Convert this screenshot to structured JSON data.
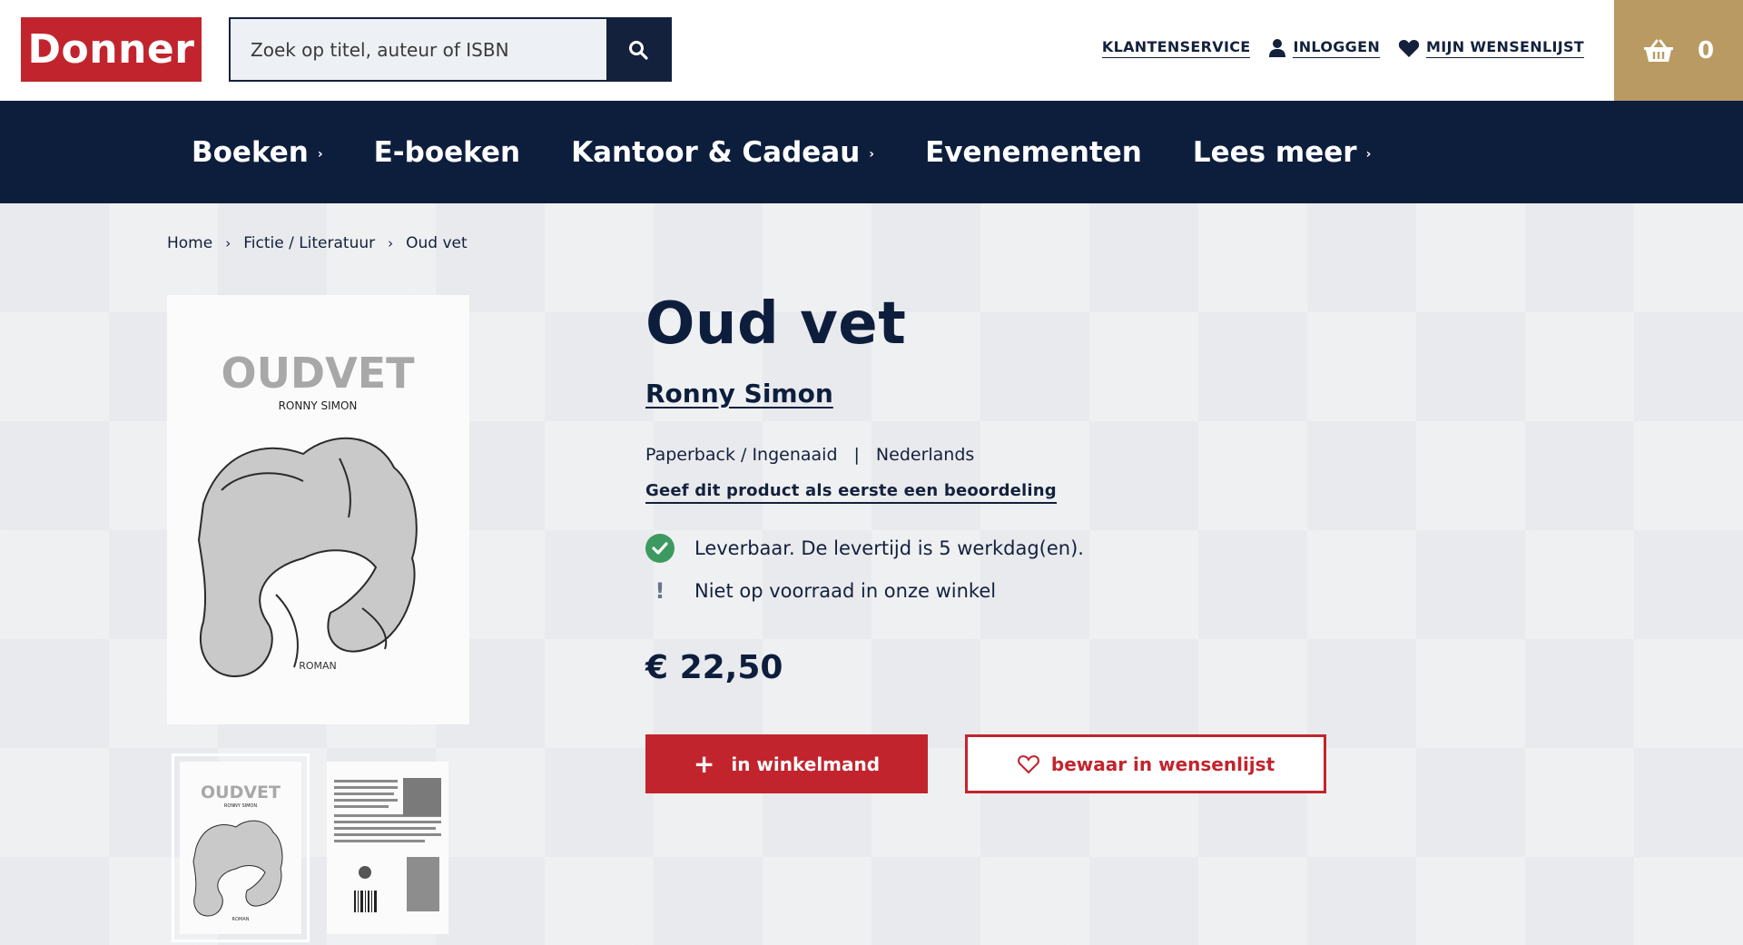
{
  "header": {
    "logo": "Donner",
    "search_placeholder": "Zoek op titel, auteur of ISBN",
    "links": {
      "customer_service": "KLANTENSERVICE",
      "login": "INLOGGEN",
      "wishlist": "MIJN WENSENLIJST"
    },
    "cart_count": "0"
  },
  "nav": {
    "items": [
      {
        "label": "Boeken",
        "has_caret": true
      },
      {
        "label": "E-boeken",
        "has_caret": false
      },
      {
        "label": "Kantoor & Cadeau",
        "has_caret": true
      },
      {
        "label": "Evenementen",
        "has_caret": false
      },
      {
        "label": "Lees meer",
        "has_caret": true
      }
    ],
    "caret": "›"
  },
  "breadcrumb": {
    "items": [
      "Home",
      "Fictie / Literatuur",
      "Oud vet"
    ],
    "separator": "›"
  },
  "cover": {
    "title": "OUDVET",
    "author": "RONNY SIMON",
    "genre": "ROMAN"
  },
  "product": {
    "title": "Oud vet",
    "author": "Ronny Simon",
    "format": "Paperback / Ingenaaid",
    "meta_separator": "|",
    "language": "Nederlands",
    "review_link": "Geef dit product als eerste een beoordeling",
    "availability": "Leverbaar. De levertijd is 5 werkdag(en).",
    "store_stock": "Niet op voorraad in onze winkel",
    "price": "€ 22,50",
    "add_to_cart": "in winkelmand",
    "add_to_wishlist": "bewaar in wensenlijst"
  },
  "colors": {
    "brand_red": "#c2242d",
    "navy": "#0d1e3d",
    "cart_gold": "#b99a63",
    "success_green": "#3c9a5f"
  }
}
